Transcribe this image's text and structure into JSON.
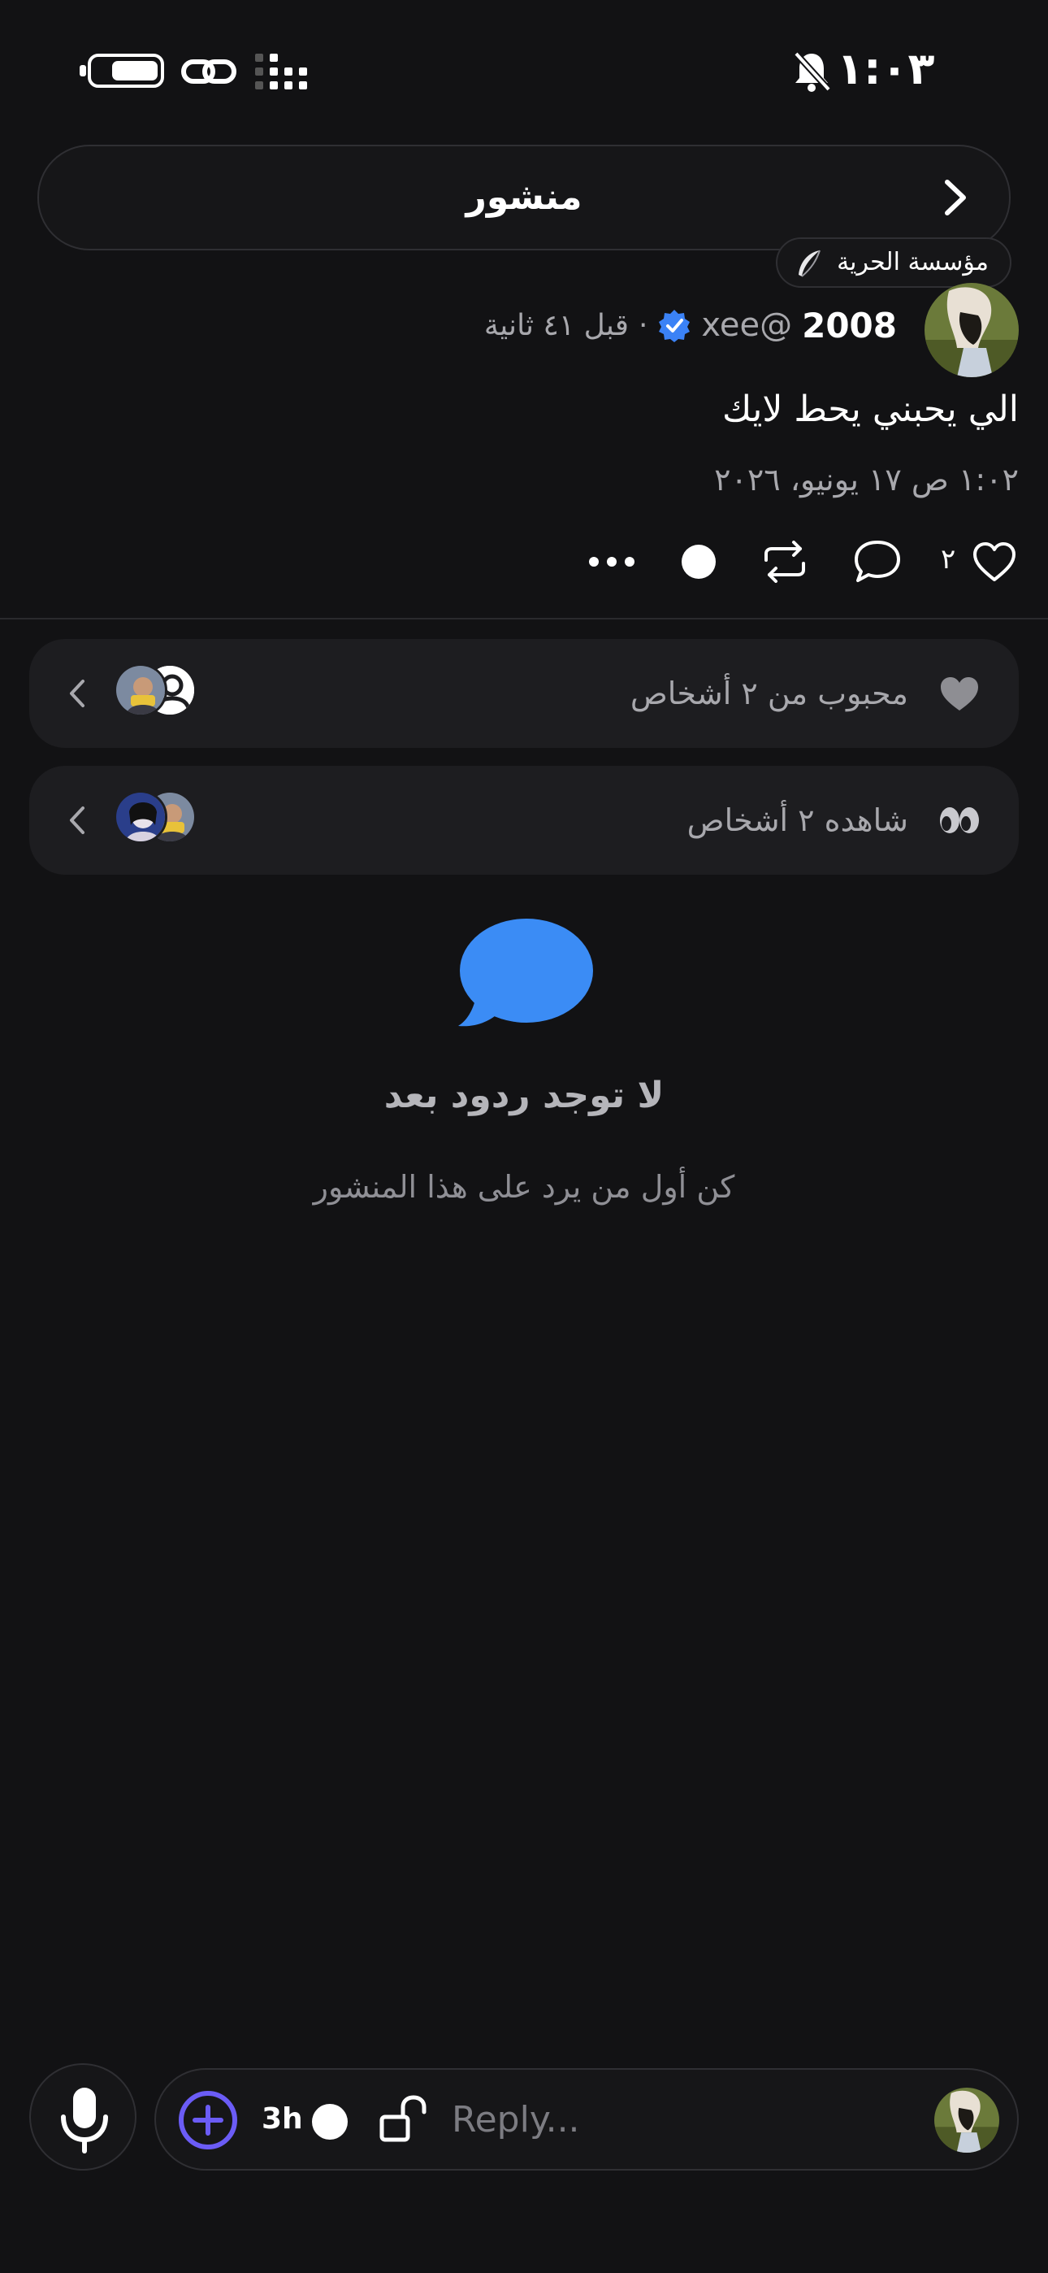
{
  "status_bar": {
    "time": "١:٠٣",
    "icons": [
      "battery-icon",
      "link-icon",
      "signal-icon",
      "bell-off-icon"
    ]
  },
  "header": {
    "title": "منشور",
    "back_icon": "chevron-icon"
  },
  "org_badge": {
    "label": "مؤسسة الحرية",
    "icon": "feather-icon"
  },
  "post": {
    "display_name": "2008",
    "handle": "@xee",
    "separator": "·",
    "time_ago": "قبل ٤١ ثانية",
    "text": "الي يحبني يحط لايك",
    "timestamp": "١:٠٢ ص ١٧ يونيو، ٢٠٢٦",
    "like_count": "٢",
    "accent_color": "#3b82f6"
  },
  "pills": {
    "liked": {
      "label": "محبوب من ٢ أشخاص",
      "icon": "heart-icon"
    },
    "viewed": {
      "label": "شاهده ٢ أشخاص",
      "icon": "eyes-icon"
    }
  },
  "empty_state": {
    "title": "لا توجد ردود بعد",
    "subtitle": "كن أول من يرد على هذا المنشور",
    "icon": "message-bubble-icon",
    "icon_color": "#3b8cf5"
  },
  "composer": {
    "duration": "3h",
    "placeholder": "Reply...",
    "plus_color": "#6b5cf6"
  }
}
